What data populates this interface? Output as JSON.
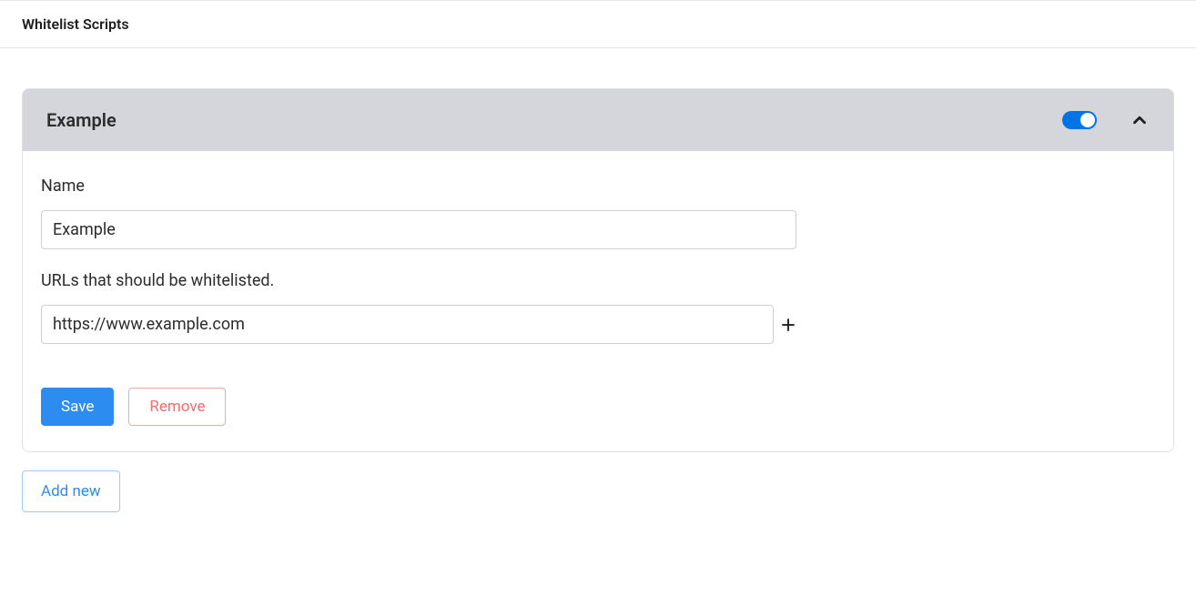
{
  "header": {
    "title": "Whitelist Scripts"
  },
  "panel": {
    "title": "Example",
    "toggle_on": true,
    "expanded": true,
    "fields": {
      "name_label": "Name",
      "name_value": "Example",
      "urls_label": "URLs that should be whitelisted.",
      "url_value": "https://www.example.com"
    },
    "buttons": {
      "save_label": "Save",
      "remove_label": "Remove"
    }
  },
  "footer": {
    "add_new_label": "Add new"
  },
  "colors": {
    "accent": "#2d8cf0",
    "danger": "#f56c6c",
    "panel_header_bg": "#d4d6db"
  }
}
